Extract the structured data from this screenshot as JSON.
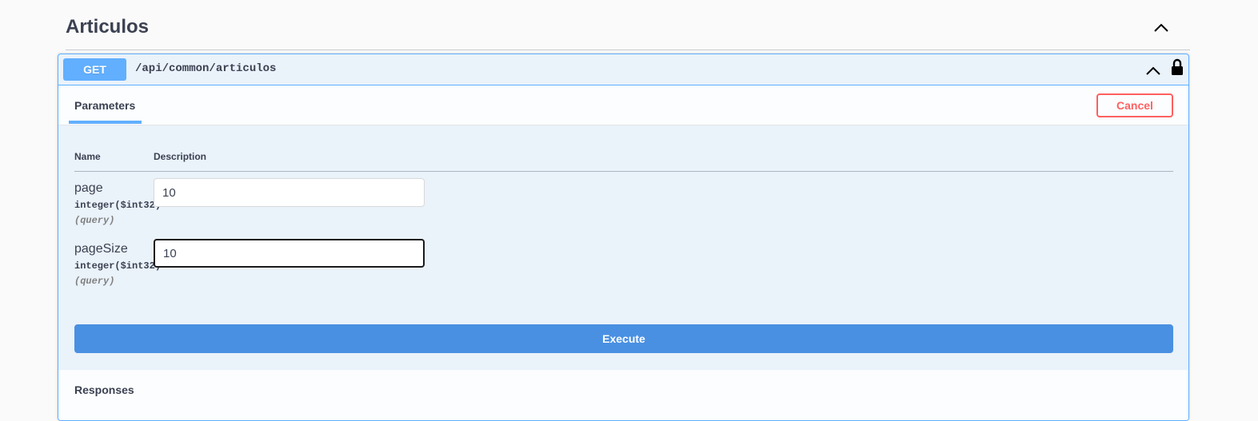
{
  "tag": {
    "title": "Articulos"
  },
  "operation": {
    "method": "GET",
    "path": "/api/common/articulos",
    "method_color": "#61affe"
  },
  "tabs": {
    "parameters_label": "Parameters",
    "cancel_label": "Cancel"
  },
  "table": {
    "col_name": "Name",
    "col_description": "Description"
  },
  "parameters": [
    {
      "name": "page",
      "type": "integer($int32)",
      "in": "(query)",
      "value": "10"
    },
    {
      "name": "pageSize",
      "type": "integer($int32)",
      "in": "(query)",
      "value": "10"
    }
  ],
  "actions": {
    "execute_label": "Execute"
  },
  "responses": {
    "title": "Responses"
  },
  "icons": {
    "tag_collapse": "chevron-up-icon",
    "op_collapse": "chevron-up-icon",
    "auth": "lock-icon"
  },
  "colors": {
    "execute": "#4990e2",
    "cancel": "#ff6060"
  }
}
